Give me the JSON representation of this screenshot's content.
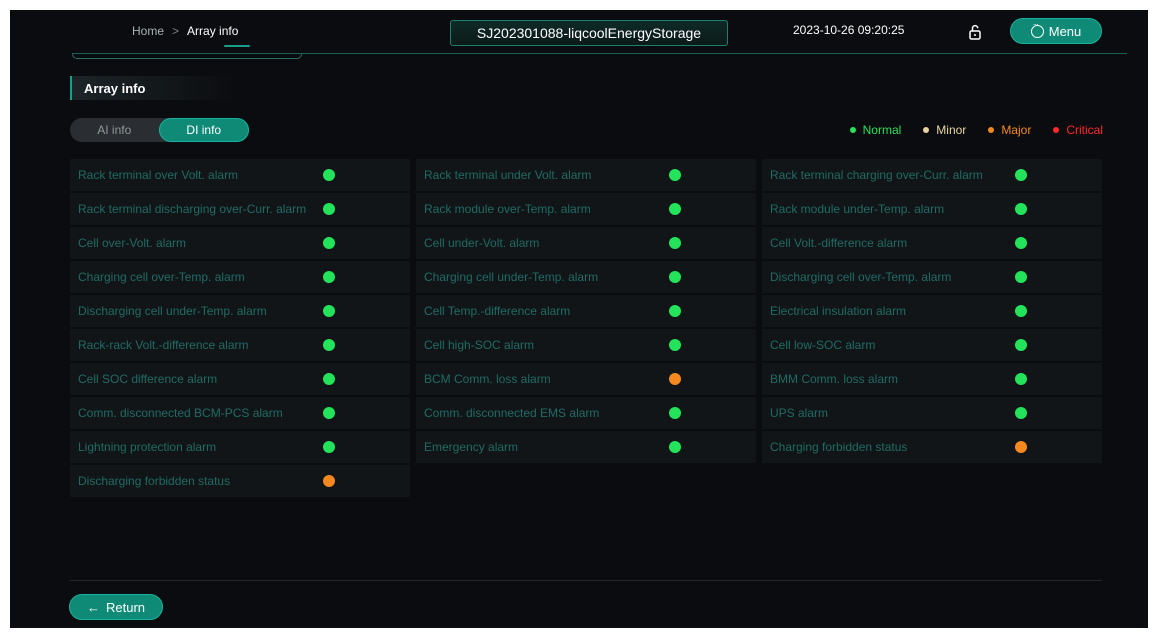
{
  "header": {
    "breadcrumb": {
      "home": "Home",
      "separator": ">",
      "current": "Array info"
    },
    "station_name": "SJ202301088-liqcoolEnergyStorage",
    "datetime": "2023-10-26 09:20:25",
    "lock_icon": "lock-open-icon",
    "menu_label": "Menu"
  },
  "section_title": "Array info",
  "tabs": [
    {
      "label": "AI info",
      "active": false
    },
    {
      "label": "DI info",
      "active": true
    }
  ],
  "legend": [
    {
      "label": "Normal",
      "color": "#22e35a"
    },
    {
      "label": "Minor",
      "color": "#e5d4a0"
    },
    {
      "label": "Major",
      "color": "#f5891f"
    },
    {
      "label": "Critical",
      "color": "#ff2a2a"
    }
  ],
  "status_colors": {
    "normal": "#22e35a",
    "major": "#f5891f"
  },
  "columns": [
    [
      {
        "label": "Rack terminal over Volt. alarm",
        "status": "normal"
      },
      {
        "label": "Rack terminal discharging over-Curr. alarm",
        "status": "normal"
      },
      {
        "label": "Cell over-Volt. alarm",
        "status": "normal"
      },
      {
        "label": "Charging cell over-Temp. alarm",
        "status": "normal"
      },
      {
        "label": "Discharging cell under-Temp. alarm",
        "status": "normal"
      },
      {
        "label": "Rack-rack Volt.-difference alarm",
        "status": "normal"
      },
      {
        "label": "Cell SOC difference alarm",
        "status": "normal"
      },
      {
        "label": "Comm. disconnected BCM-PCS alarm",
        "status": "normal"
      },
      {
        "label": "Lightning protection alarm",
        "status": "normal"
      },
      {
        "label": "Discharging forbidden status",
        "status": "major"
      }
    ],
    [
      {
        "label": "Rack terminal under Volt. alarm",
        "status": "normal"
      },
      {
        "label": "Rack module over-Temp. alarm",
        "status": "normal"
      },
      {
        "label": "Cell under-Volt. alarm",
        "status": "normal"
      },
      {
        "label": "Charging cell under-Temp. alarm",
        "status": "normal"
      },
      {
        "label": "Cell Temp.-difference alarm",
        "status": "normal"
      },
      {
        "label": "Cell high-SOC alarm",
        "status": "normal"
      },
      {
        "label": "BCM Comm. loss alarm",
        "status": "major"
      },
      {
        "label": "Comm. disconnected EMS alarm",
        "status": "normal"
      },
      {
        "label": "Emergency alarm",
        "status": "normal"
      }
    ],
    [
      {
        "label": "Rack terminal charging over-Curr. alarm",
        "status": "normal"
      },
      {
        "label": "Rack module under-Temp. alarm",
        "status": "normal"
      },
      {
        "label": "Cell Volt.-difference alarm",
        "status": "normal"
      },
      {
        "label": "Discharging cell over-Temp. alarm",
        "status": "normal"
      },
      {
        "label": "Electrical insulation alarm",
        "status": "normal"
      },
      {
        "label": "Cell low-SOC alarm",
        "status": "normal"
      },
      {
        "label": "BMM Comm. loss alarm",
        "status": "normal"
      },
      {
        "label": "UPS alarm",
        "status": "normal"
      },
      {
        "label": "Charging forbidden status",
        "status": "major"
      }
    ]
  ],
  "return_label": "Return"
}
